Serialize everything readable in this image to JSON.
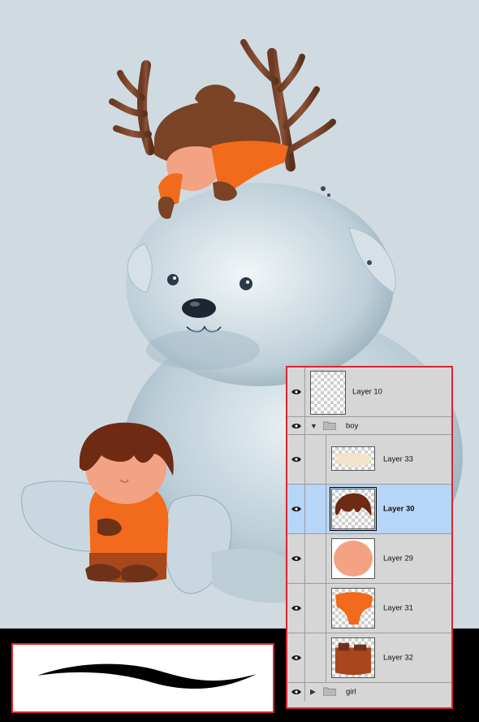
{
  "colors": {
    "canvas_bg": "#cfdbe1",
    "panel_bg": "#d6d6d6",
    "selected_row": "#b7d5f7",
    "highlight_border": "#d9262e"
  },
  "layers_panel": {
    "layers": [
      {
        "name": "Layer 10",
        "kind": "layer",
        "thumb": "empty",
        "selected": false
      },
      {
        "name": "boy",
        "kind": "group",
        "expanded": true
      },
      {
        "name": "Layer 33",
        "kind": "layer",
        "thumb": "beige-strip",
        "selected": false,
        "indent": true
      },
      {
        "name": "Layer 30",
        "kind": "layer",
        "thumb": "brown-hair",
        "selected": true,
        "indent": true
      },
      {
        "name": "Layer 29",
        "kind": "layer",
        "thumb": "skin-face",
        "selected": false,
        "indent": true
      },
      {
        "name": "Layer 31",
        "kind": "layer",
        "thumb": "orange-sweater",
        "selected": false,
        "indent": true
      },
      {
        "name": "Layer 32",
        "kind": "layer",
        "thumb": "brown-body",
        "selected": false,
        "indent": true
      },
      {
        "name": "girl",
        "kind": "group",
        "expanded": false
      }
    ]
  },
  "icons": {
    "visibility": "eye-icon",
    "group": "folder-icon",
    "expand": "triangle-down-icon",
    "collapse": "triangle-right-icon"
  }
}
